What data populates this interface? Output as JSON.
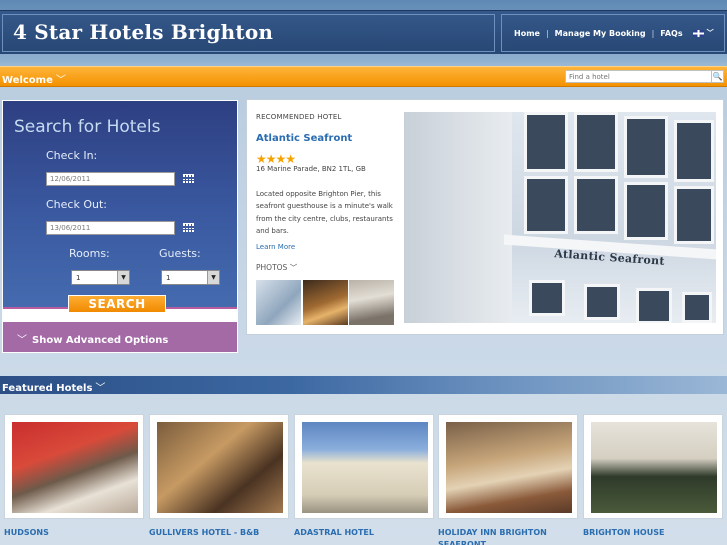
{
  "header": {
    "site_title": "4 Star Hotels Brighton",
    "nav": [
      "Home",
      "Manage My Booking",
      "FAQs"
    ],
    "flag_icon": "uk-flag-icon"
  },
  "welcome_bar": {
    "label": "Welcome",
    "search_placeholder": "Find a hotel"
  },
  "search_panel": {
    "title": "Search for Hotels",
    "check_in_label": "Check In:",
    "check_in_value": "12/06/2011",
    "check_out_label": "Check Out:",
    "check_out_value": "13/06/2011",
    "rooms_label": "Rooms:",
    "rooms_value": "1",
    "guests_label": "Guests:",
    "guests_value": "1",
    "search_button": "SEARCH",
    "advanced_label": "Show Advanced Options"
  },
  "recommended": {
    "kicker": "RECOMMENDED HOTEL",
    "name": "Atlantic Seafront",
    "stars": "★★★★",
    "star_count": 4,
    "address": "16 Marine Parade, BN2 1TL, GB",
    "description": "Located opposite Brighton Pier, this seafront guesthouse is a minute's walk from the city centre, clubs, restaurants and bars.",
    "learn_more": "Learn More",
    "photos_label": "PHOTOS",
    "hero_sign": "Atlantic Seafront"
  },
  "featured": {
    "label": "Featured Hotels",
    "hotels": [
      {
        "name": "HUDSONS"
      },
      {
        "name": "GULLIVERS HOTEL - B&B"
      },
      {
        "name": "ADASTRAL HOTEL"
      },
      {
        "name": "HOLIDAY INN BRIGHTON SEAFRONT"
      },
      {
        "name": "BRIGHTON HOUSE"
      }
    ]
  },
  "colors": {
    "header_bg": "#2c4c7c",
    "orange_bar": "#f39200",
    "link_blue": "#2a6db0",
    "advanced_purple": "#a36aa6",
    "star_orange": "#f6a300"
  }
}
